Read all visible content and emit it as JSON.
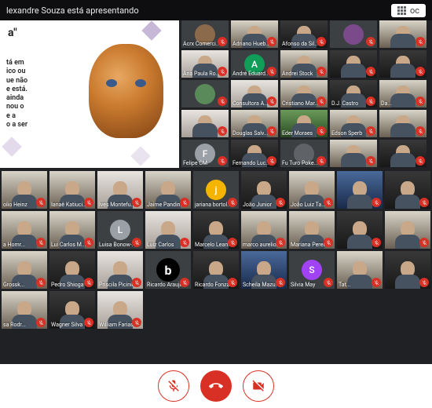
{
  "header": {
    "presenting_text": "lexandre Souza está apresentando",
    "layout_button": "oc"
  },
  "presentation": {
    "title": "a\"",
    "body": "tá em\nico ou\nue não\ne está.\n ainda\nnou o\n e a\no a ser"
  },
  "colors": {
    "mute": "#d93025",
    "bg": "#202124"
  },
  "rows": [
    [
      {
        "name": "Acrx Comerci...",
        "type": "avatar",
        "letter": "",
        "color": "#8a6a4a"
      },
      {
        "name": "Adriano Hueb...",
        "type": "cam",
        "variant": "room"
      },
      {
        "name": "Afonso da Sil...",
        "type": "cam",
        "variant": "dark"
      },
      {
        "name": "",
        "type": "avatar",
        "letter": "",
        "color": "#7a4a8a"
      },
      {
        "name": "",
        "type": "cam",
        "variant": "room"
      }
    ],
    [
      {
        "name": "Ana Paula Ro...",
        "type": "cam",
        "variant": "light"
      },
      {
        "name": "André Eduard...",
        "type": "avatar",
        "letter": "A",
        "color": "#0f9d58"
      },
      {
        "name": "Andrei Stock",
        "type": "cam",
        "variant": "room"
      },
      {
        "name": "",
        "type": "cam",
        "variant": "dark"
      },
      {
        "name": "",
        "type": "cam",
        "variant": "dark"
      }
    ],
    [
      {
        "name": "",
        "type": "avatar",
        "letter": "",
        "color": "#5a8a5a"
      },
      {
        "name": "Consultora A...",
        "type": "cam",
        "variant": "light"
      },
      {
        "name": "Cristiano Mar...",
        "type": "cam",
        "variant": "room"
      },
      {
        "name": "D.J. Castro",
        "type": "cam",
        "variant": "dark"
      },
      {
        "name": "Da...",
        "type": "cam",
        "variant": "room"
      }
    ],
    [
      {
        "name": "",
        "type": "cam",
        "variant": "light"
      },
      {
        "name": "Douglas Salv...",
        "type": "cam",
        "variant": "room"
      },
      {
        "name": "Eder Moraes",
        "type": "cam",
        "variant": "green"
      },
      {
        "name": "Edson Sperb",
        "type": "cam",
        "variant": "room"
      },
      {
        "name": "",
        "type": "cam",
        "variant": "room"
      }
    ],
    [
      {
        "name": "Felipe CM",
        "type": "avatar",
        "letter": "F",
        "color": "#9aa0a6"
      },
      {
        "name": "Fernando Luc...",
        "type": "cam",
        "variant": "dark"
      },
      {
        "name": "Fu Turo Poke...",
        "type": "avatar",
        "letter": "",
        "color": "#5f6368"
      },
      {
        "name": "",
        "type": "cam",
        "variant": "room"
      },
      {
        "name": "",
        "type": "cam",
        "variant": "dark"
      }
    ]
  ],
  "bottom": [
    [
      {
        "name": "olio Heinz",
        "type": "cam",
        "variant": "room"
      },
      {
        "name": "Ianaê Katiuci...",
        "type": "cam",
        "variant": "room"
      },
      {
        "name": "Ives Montefu...",
        "type": "cam",
        "variant": "light"
      },
      {
        "name": "Jaime Pandin...",
        "type": "cam",
        "variant": "room"
      },
      {
        "name": "jariana bortol...",
        "type": "avatar",
        "letter": "j",
        "color": "#f4b400"
      },
      {
        "name": "João Junior",
        "type": "cam",
        "variant": "dark"
      },
      {
        "name": "João Luiz Ta...",
        "type": "cam",
        "variant": "room"
      },
      {
        "name": "",
        "type": "cam",
        "variant": "blue"
      },
      {
        "name": "",
        "type": "cam",
        "variant": "dark"
      }
    ],
    [
      {
        "name": "a Homr...",
        "type": "cam",
        "variant": "room"
      },
      {
        "name": "Lui Carlos M...",
        "type": "cam",
        "variant": "room"
      },
      {
        "name": "Luisa Bonow-...",
        "type": "avatar",
        "letter": "L",
        "color": "#9aa0a6"
      },
      {
        "name": "Luiz Carlos",
        "type": "cam",
        "variant": "light"
      },
      {
        "name": "Marcelo Lean...",
        "type": "cam",
        "variant": "dark"
      },
      {
        "name": "marco aurelio...",
        "type": "cam",
        "variant": "room"
      },
      {
        "name": "Mariana Perei...",
        "type": "cam",
        "variant": "room"
      },
      {
        "name": "",
        "type": "cam",
        "variant": "dark"
      },
      {
        "name": "",
        "type": "cam",
        "variant": "room"
      }
    ],
    [
      {
        "name": "Grossk...",
        "type": "cam",
        "variant": "room"
      },
      {
        "name": "Pedro Shioga",
        "type": "cam",
        "variant": "dark"
      },
      {
        "name": "Priscila Picinini",
        "type": "cam",
        "variant": "light"
      },
      {
        "name": "Ricardo Araujo",
        "type": "logo",
        "letter": "b"
      },
      {
        "name": "Ricardo Fonza",
        "type": "cam",
        "variant": "dark"
      },
      {
        "name": "Scheila Mazu...",
        "type": "cam",
        "variant": "blue"
      },
      {
        "name": "Silvia May",
        "type": "avatar",
        "letter": "S",
        "color": "#a142f4"
      },
      {
        "name": "Tat...",
        "type": "cam",
        "variant": "room"
      },
      {
        "name": "",
        "type": "cam",
        "variant": "dark"
      }
    ],
    [
      {
        "name": "sa Rodr...",
        "type": "cam",
        "variant": "room"
      },
      {
        "name": "Wagner Silva",
        "type": "cam",
        "variant": "dark"
      },
      {
        "name": "William Farias",
        "type": "cam",
        "variant": "light"
      }
    ]
  ],
  "controls": {
    "mic": "microphone-muted",
    "hangup": "hang-up",
    "camera": "camera-off"
  }
}
